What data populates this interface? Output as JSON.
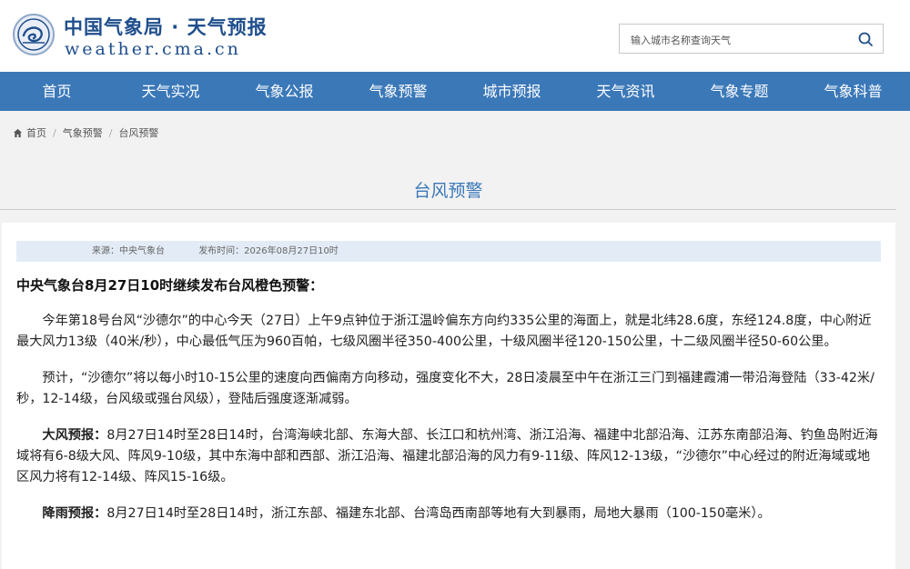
{
  "header": {
    "site_title": "中国气象局 · 天气预报",
    "site_url": "weather.cma.cn",
    "search_placeholder": "输入城市名称查询天气"
  },
  "nav": [
    "首页",
    "天气实况",
    "气象公报",
    "气象预警",
    "城市预报",
    "天气资讯",
    "气象专题",
    "气象科普"
  ],
  "breadcrumb": [
    "首页",
    "气象预警",
    "台风预警"
  ],
  "page_title": "台风预警",
  "meta": {
    "source": "来源：中央气象台",
    "time": "发布时间：2026年08月27日10时"
  },
  "article": {
    "headline": "中央气象台8月27日10时继续发布台风橙色预警：",
    "p1": "今年第18号台风“沙德尔”的中心今天（27日）上午9点钟位于浙江温岭偏东方向约335公里的海面上，就是北纬28.6度，东经124.8度，中心附近最大风力13级（40米/秒），中心最低气压为960百帕，七级风圈半径350-400公里，十级风圈半径120-150公里，十二级风圈半径50-60公里。",
    "p2": "预计，“沙德尔”将以每小时10-15公里的速度向西偏南方向移动，强度变化不大，28日凌晨至中午在浙江三门到福建霞浦一带沿海登陆（33-42米/秒，12-14级，台风级或强台风级），登陆后强度逐渐减弱。",
    "p3_label": "大风预报：",
    "p3": "8月27日14时至28日14时，台湾海峡北部、东海大部、长江口和杭州湾、浙江沿海、福建中北部沿海、江苏东南部沿海、钓鱼岛附近海域将有6-8级大风、阵风9-10级，其中东海中部和西部、浙江沿海、福建北部沿海的风力有9-11级、阵风12-13级，“沙德尔”中心经过的附近海域或地区风力将有12-14级、阵风15-16级。",
    "p4_label": "降雨预报：",
    "p4": "8月27日14时至28日14时，浙江东部、福建东北部、台湾岛西南部等地有大到暴雨，局地大暴雨（100-150毫米）。"
  },
  "colors": {
    "brand": "#1f4e8c",
    "nav_bg": "#3b78b8",
    "meta_bg": "#e3ecf6"
  },
  "icons": {
    "logo": "cma-logo-icon",
    "search": "search-icon",
    "home": "home-icon"
  }
}
